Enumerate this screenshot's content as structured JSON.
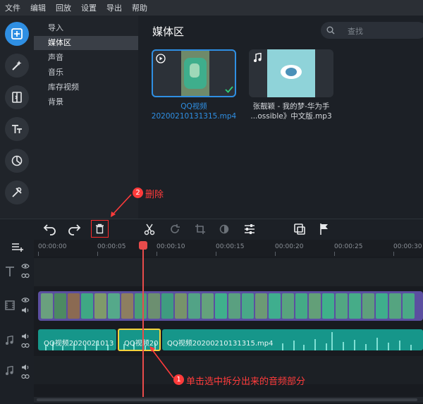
{
  "menu": [
    "文件",
    "编辑",
    "回放",
    "设置",
    "导出",
    "帮助"
  ],
  "nav": {
    "items": [
      "导入",
      "媒体区",
      "声音",
      "音乐",
      "库存视频",
      "背景"
    ],
    "selected_index": 1
  },
  "media": {
    "title": "媒体区",
    "search_placeholder": "查找",
    "items": [
      {
        "line1": "QQ视频",
        "line2": "20200210131315.mp4",
        "selected": true
      },
      {
        "line1": "张靓颖 - 我的梦-华为手",
        "line2": "...ossible》中文版.mp3",
        "selected": false
      }
    ]
  },
  "timeline": {
    "ticks": [
      "00:00:00",
      "00:00:05",
      "00:00:10",
      "00:00:15",
      "00:00:20",
      "00:00:25",
      "00:00:30"
    ],
    "clips": [
      {
        "label": "QQ视频2020021013"
      },
      {
        "label": "QQ视频20"
      },
      {
        "label": "QQ视频20200210131315.mp4"
      }
    ]
  },
  "annotations": {
    "step1_num": "1",
    "step1_text": "单击选中拆分出来的音频部分",
    "step2_num": "2",
    "step2_text": "删除"
  },
  "colors": {
    "accent": "#2f8fe3",
    "audio_clip": "#16968a",
    "selection": "#f5d23c",
    "annotation": "#ff3b3b",
    "video_clip": "#5b4fa0"
  }
}
